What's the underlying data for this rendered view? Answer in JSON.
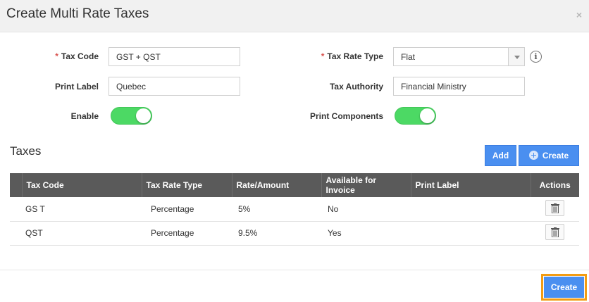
{
  "dialog": {
    "title": "Create Multi Rate Taxes",
    "close": "×"
  },
  "form": {
    "required_mark": "*",
    "tax_code_label": "Tax Code",
    "tax_code_value": "GST + QST",
    "print_label_label": "Print Label",
    "print_label_value": "Quebec",
    "enable_label": "Enable",
    "enable_state": true,
    "tax_rate_type_label": "Tax Rate Type",
    "tax_rate_type_value": "Flat",
    "tax_authority_label": "Tax Authority",
    "tax_authority_value": "Financial Ministry",
    "print_components_label": "Print Components",
    "print_components_state": true,
    "info_icon": "i"
  },
  "taxes": {
    "title": "Taxes",
    "add_label": "Add",
    "create_label": "Create",
    "columns": [
      "Tax Code",
      "Tax Rate Type",
      "Rate/Amount",
      "Available for Invoice",
      "Print Label",
      "Actions"
    ],
    "rows": [
      {
        "tax_code": "GS T",
        "rate_type": "Percentage",
        "rate": "5%",
        "available": "No",
        "print_label": ""
      },
      {
        "tax_code": "QST",
        "rate_type": "Percentage",
        "rate": "9.5%",
        "available": "Yes",
        "print_label": ""
      }
    ]
  },
  "footer": {
    "create_label": "Create"
  },
  "colors": {
    "accent": "#4a8ff0",
    "toggle_on": "#4cd964",
    "highlight": "#f39c12",
    "table_header": "#5a5a5a"
  }
}
